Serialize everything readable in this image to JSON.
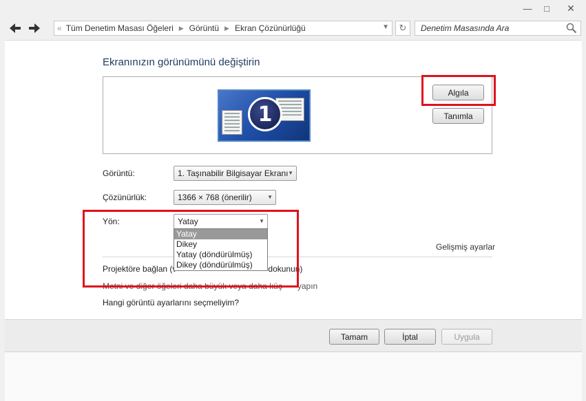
{
  "window": {
    "minimize": "—",
    "maximize": "□",
    "close": "✕"
  },
  "nav": {
    "breadcrumb": [
      "Tüm Denetim Masası Öğeleri",
      "Görüntü",
      "Ekran Çözünürlüğü"
    ],
    "search_placeholder": "Denetim Masasında Ara"
  },
  "page": {
    "title": "Ekranınızın görünümünü değiştirin",
    "monitor_number": "1",
    "detect_label": "Algıla",
    "identify_label": "Tanımla"
  },
  "form": {
    "display_label": "Görüntü:",
    "display_value": "1. Taşınabilir Bilgisayar Ekranı",
    "resolution_label": "Çözünürlük:",
    "resolution_value": "1366 × 768 (önerilir)",
    "orientation_label": "Yön:",
    "orientation_value": "Yatay",
    "orientation_options": [
      "Yatay",
      "Dikey",
      "Yatay (döndürülmüş)",
      "Dikey (döndürülmüş)"
    ],
    "orientation_selected_index": 0
  },
  "links": {
    "advanced": "Gelişmiş ayarlar",
    "projector_start": "Projektöre bağlan (v",
    "projector_end": "dokunun)",
    "text_size_start": "Metni ve diğer öğeleri daha büyük veya daha küç",
    "text_size_end": "yapın",
    "which_settings": "Hangi görüntü ayarlarını seçmeliyim?"
  },
  "buttons": {
    "ok": "Tamam",
    "cancel": "İptal",
    "apply": "Uygula"
  },
  "colors": {
    "highlight_box": "#e0101c",
    "monitor_blue": "#1f4fa8"
  }
}
